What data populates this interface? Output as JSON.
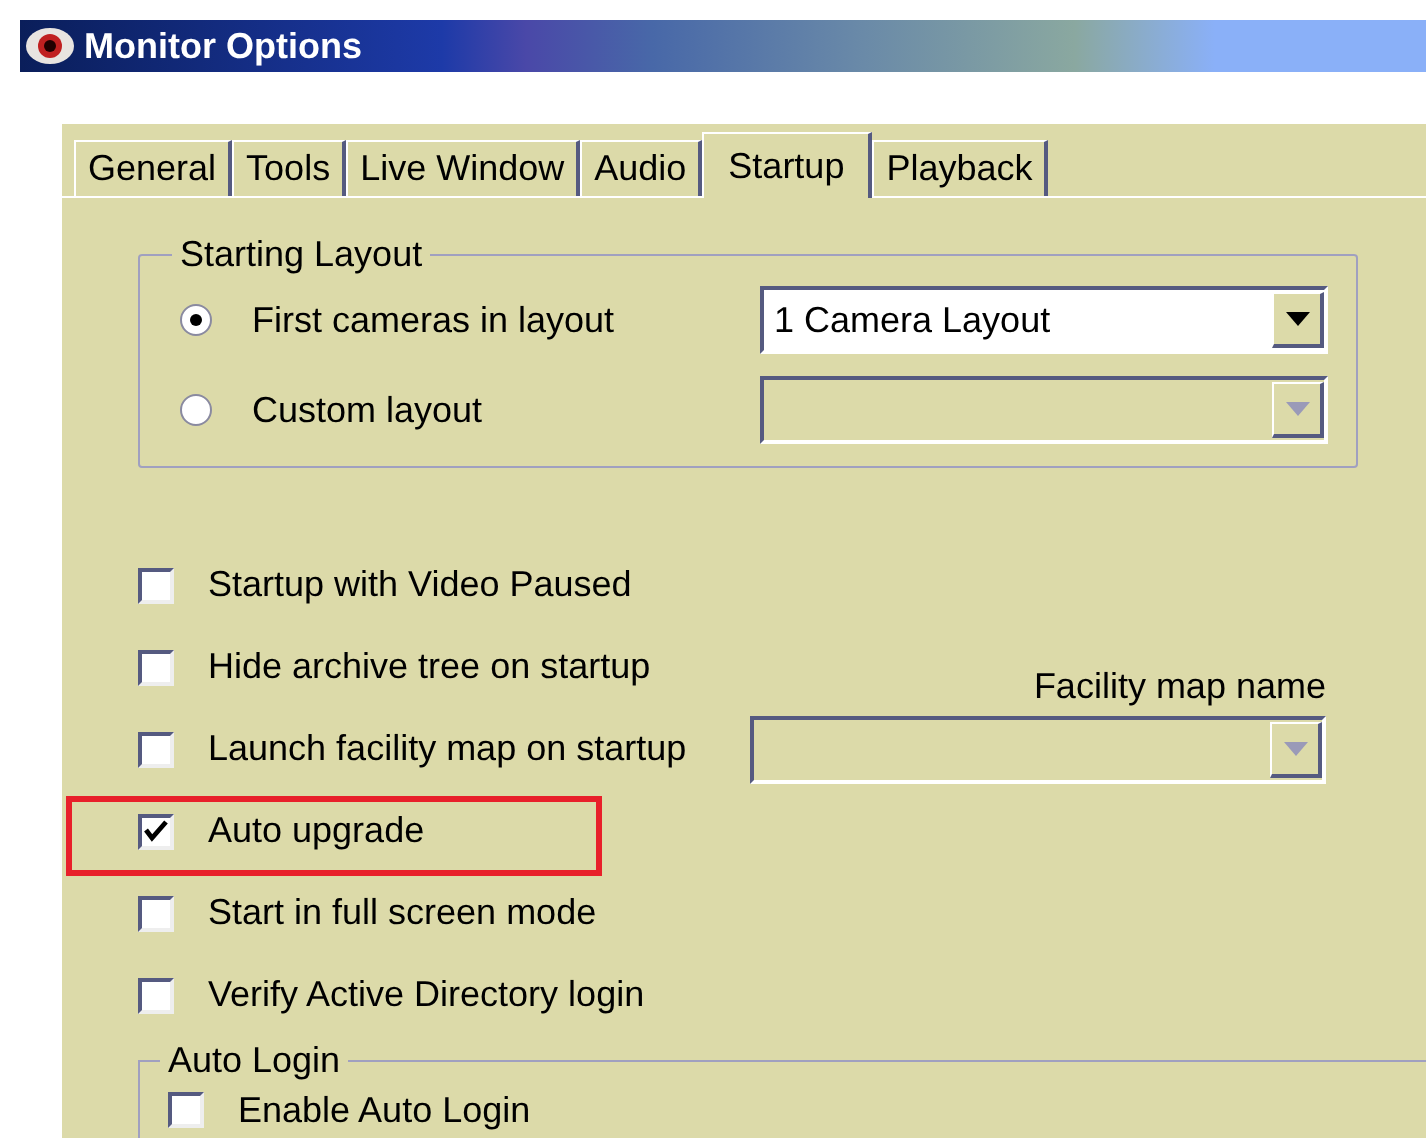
{
  "window": {
    "title": "Monitor Options"
  },
  "tabs": [
    {
      "label": "General",
      "selected": false
    },
    {
      "label": "Tools",
      "selected": false
    },
    {
      "label": "Live Window",
      "selected": false
    },
    {
      "label": "Audio",
      "selected": false
    },
    {
      "label": "Startup",
      "selected": true
    },
    {
      "label": "Playback",
      "selected": false
    }
  ],
  "starting_layout": {
    "title": "Starting Layout",
    "options": [
      {
        "label": "First cameras in layout",
        "selected": true,
        "dropdown": {
          "value": "1 Camera Layout",
          "disabled": false
        }
      },
      {
        "label": "Custom layout",
        "selected": false,
        "dropdown": {
          "disabled": true
        }
      }
    ]
  },
  "checkboxes": [
    {
      "label": "Startup with Video Paused",
      "checked": false,
      "highlighted": false
    },
    {
      "label": "Hide archive tree on startup",
      "checked": false,
      "highlighted": false,
      "side_label": "Facility map name"
    },
    {
      "label": "Launch facility map on startup",
      "checked": false,
      "highlighted": false,
      "side_dropdown": {
        "disabled": true
      }
    },
    {
      "label": "Auto upgrade",
      "checked": true,
      "highlighted": true
    },
    {
      "label": "Start in full screen mode",
      "checked": false,
      "highlighted": false
    },
    {
      "label": "Verify Active Directory login",
      "checked": false,
      "highlighted": false
    }
  ],
  "auto_login": {
    "title": "Auto Login",
    "checkboxes": [
      {
        "label": "Enable Auto Login",
        "checked": false
      }
    ]
  }
}
